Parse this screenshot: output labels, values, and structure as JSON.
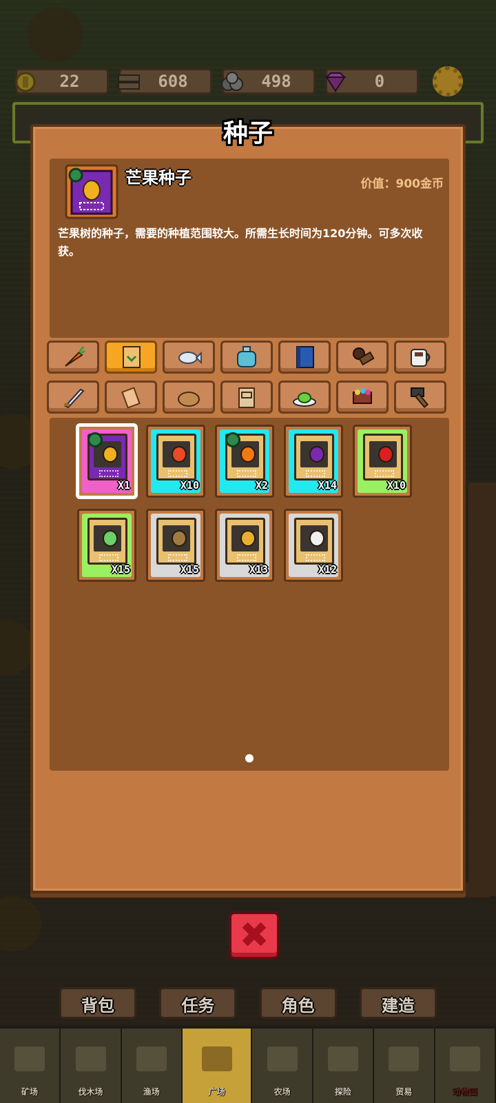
{
  "resources": [
    {
      "icon": "coin-icon",
      "value": "22"
    },
    {
      "icon": "wood-icon",
      "value": "608"
    },
    {
      "icon": "stone-icon",
      "value": "498"
    },
    {
      "icon": "gem-icon",
      "value": "0"
    }
  ],
  "modal": {
    "title": "种子",
    "selected_item": {
      "name": "芒果种子",
      "value_label": "价值：900金币",
      "description": "芒果树的种子，需要的种植范围较大。所需生长时间为120分钟。可多次收获。"
    },
    "categories_row1": [
      "carrot-icon",
      "seed-packet-icon",
      "fish-icon",
      "potion-icon",
      "book-icon",
      "coffee-beans-icon",
      "cup-icon"
    ],
    "categories_row2": [
      "sword-icon",
      "scroll-icon",
      "bread-icon",
      "frame-icon",
      "dish-icon",
      "cart-icon",
      "hammer-icon"
    ],
    "active_category": 1,
    "items": [
      {
        "name": "mango-seed",
        "qty": "X1",
        "bg": "#f060c8",
        "fill": "#f0b020",
        "badge": true
      },
      {
        "name": "tomato-seed",
        "qty": "X10",
        "bg": "#22e8f0",
        "fill": "#e84a2a",
        "badge": false
      },
      {
        "name": "orange-seed",
        "qty": "X2",
        "bg": "#22e8f0",
        "fill": "#f07a10",
        "badge": true
      },
      {
        "name": "eggplant-seed",
        "qty": "X14",
        "bg": "#22e8f0",
        "fill": "#7a2ab0",
        "badge": false
      },
      {
        "name": "chili-seed",
        "qty": "X10",
        "bg": "#9af060",
        "fill": "#d82020",
        "badge": false
      },
      {
        "name": "cabbage-seed",
        "qty": "X15",
        "bg": "#9af060",
        "fill": "#6ad06a",
        "badge": false
      },
      {
        "name": "potato-seed",
        "qty": "X15",
        "bg": "#d8d8d8",
        "fill": "#a07a40",
        "badge": false
      },
      {
        "name": "wheat-seed",
        "qty": "X13",
        "bg": "#d8d8d8",
        "fill": "#e8b030",
        "badge": false
      },
      {
        "name": "radish-seed",
        "qty": "X12",
        "bg": "#d8d8d8",
        "fill": "#f0f0f0",
        "badge": false
      }
    ],
    "close_label": "✖"
  },
  "actions": [
    "背包",
    "任务",
    "角色",
    "建造"
  ],
  "tabs": [
    {
      "label": "矿场",
      "active": false
    },
    {
      "label": "伐木场",
      "active": false
    },
    {
      "label": "渔场",
      "active": false
    },
    {
      "label": "广场",
      "active": true
    },
    {
      "label": "农场",
      "active": false
    },
    {
      "label": "探险",
      "active": false
    },
    {
      "label": "贸易",
      "active": false
    },
    {
      "label": "动物园",
      "active": false
    }
  ],
  "colors": {
    "panel": "#c27a42",
    "panel_dark": "#8b5428",
    "accent": "#f6a623",
    "close": "#e83a4a"
  }
}
